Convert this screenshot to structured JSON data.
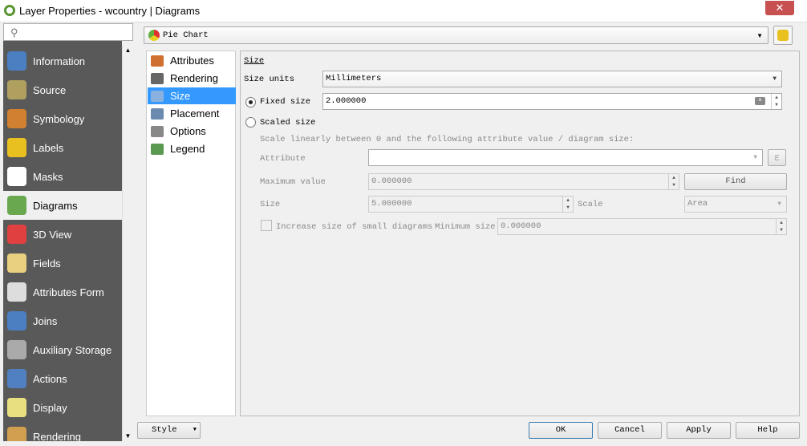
{
  "window": {
    "title": "Layer Properties - wcountry | Diagrams",
    "close": "✕"
  },
  "search": {
    "placeholder": ""
  },
  "sidebar": {
    "items": [
      {
        "label": "Information",
        "color": "#4a7fc1"
      },
      {
        "label": "Source",
        "color": "#b0a060"
      },
      {
        "label": "Symbology",
        "color": "#d08030"
      },
      {
        "label": "Labels",
        "color": "#e8c020"
      },
      {
        "label": "Masks",
        "color": "#ffffff"
      },
      {
        "label": "Diagrams",
        "color": "#6aa84f"
      },
      {
        "label": "3D View",
        "color": "#e04040"
      },
      {
        "label": "Fields",
        "color": "#e8d080"
      },
      {
        "label": "Attributes Form",
        "color": "#dddddd"
      },
      {
        "label": "Joins",
        "color": "#4a7fc1"
      },
      {
        "label": "Auxiliary Storage",
        "color": "#aaaaaa"
      },
      {
        "label": "Actions",
        "color": "#5080c0"
      },
      {
        "label": "Display",
        "color": "#e8e080"
      },
      {
        "label": "Rendering",
        "color": "#d0a050"
      }
    ],
    "selected": "Diagrams"
  },
  "renderer": {
    "value": "Pie Chart"
  },
  "subtabs": {
    "items": [
      "Attributes",
      "Rendering",
      "Size",
      "Placement",
      "Options",
      "Legend"
    ],
    "selected": "Size"
  },
  "size": {
    "heading": "Size",
    "units_label": "Size units",
    "units_value": "Millimeters",
    "fixed_label": "Fixed size",
    "fixed_value": "2.000000",
    "fixed_selected": true,
    "scaled_label": "Scaled size",
    "scale_desc": "Scale linearly between 0 and the following attribute value / diagram size:",
    "attribute_label": "Attribute",
    "attribute_value": "",
    "expr_icon": "ε",
    "max_label": "Maximum value",
    "max_value": "0.000000",
    "find_label": "Find",
    "size_label": "Size",
    "size_value": "5.000000",
    "scale_label": "Scale",
    "scale_value": "Area",
    "increase_label": "Increase size of small diagrams",
    "min_label": "Minimum size",
    "min_value": "0.000000"
  },
  "footer": {
    "style": "Style",
    "ok": "OK",
    "cancel": "Cancel",
    "apply": "Apply",
    "help": "Help"
  }
}
